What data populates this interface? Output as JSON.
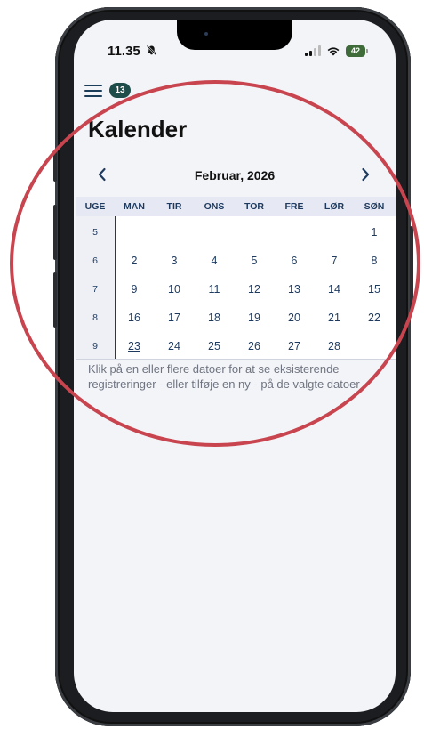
{
  "status_bar": {
    "time": "11.35",
    "silent_icon": "bell-slash-icon",
    "battery_level": "42"
  },
  "header": {
    "menu_icon": "hamburger-menu-icon",
    "badge_count": "13",
    "title": "Kalender"
  },
  "calendar": {
    "month_label": "Februar, 2026",
    "prev_icon": "chevron-left-icon",
    "next_icon": "chevron-right-icon",
    "week_header": "UGE",
    "weekdays": [
      "MAN",
      "TIR",
      "ONS",
      "TOR",
      "FRE",
      "LØR",
      "SØN"
    ],
    "weeks": [
      {
        "number": "5",
        "days": [
          "",
          "",
          "",
          "",
          "",
          "",
          "1"
        ]
      },
      {
        "number": "6",
        "days": [
          "2",
          "3",
          "4",
          "5",
          "6",
          "7",
          "8"
        ]
      },
      {
        "number": "7",
        "days": [
          "9",
          "10",
          "11",
          "12",
          "13",
          "14",
          "15"
        ]
      },
      {
        "number": "8",
        "days": [
          "16",
          "17",
          "18",
          "19",
          "20",
          "21",
          "22"
        ]
      },
      {
        "number": "9",
        "days": [
          "23",
          "24",
          "25",
          "26",
          "27",
          "28",
          ""
        ]
      }
    ],
    "today": "23",
    "accent_color": "#1e3a5f"
  },
  "hint_text": {
    "line1": "Klik på en eller flere datoer for at se eksisterende",
    "line2": "registreringer - eller tilføje en ny - på de valgte datoer"
  },
  "annotation": {
    "circle_color": "#c8454f"
  }
}
